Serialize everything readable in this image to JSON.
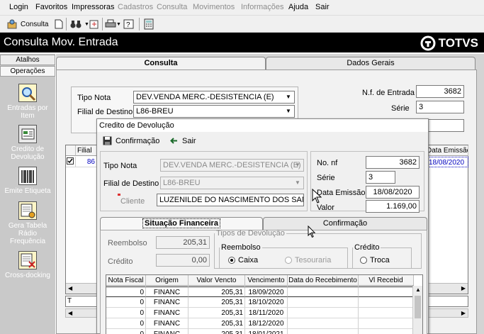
{
  "menu": {
    "items": [
      {
        "label": "Login",
        "enabled": true
      },
      {
        "label": "Favoritos",
        "enabled": true
      },
      {
        "label": "Impressoras",
        "enabled": true
      },
      {
        "label": "Cadastros",
        "enabled": false
      },
      {
        "label": "Consulta",
        "enabled": false
      },
      {
        "label": "Movimentos",
        "enabled": false
      },
      {
        "label": "Informações",
        "enabled": false
      },
      {
        "label": "Ajuda",
        "enabled": true
      },
      {
        "label": "Sair",
        "enabled": true
      }
    ]
  },
  "toolbar": {
    "consulta_label": "Consulta"
  },
  "app": {
    "title": "Consulta Mov. Entrada",
    "logo": "TOTVS"
  },
  "sidebar": {
    "tabs": [
      "Atalhos",
      "Operações"
    ],
    "items": [
      {
        "label": "Entradas por Item",
        "icon": "magnifier-icon"
      },
      {
        "label": "Credito de Devolução",
        "icon": "credit-icon"
      },
      {
        "label": "Emite Etiqueta",
        "icon": "barcode-icon"
      },
      {
        "label": "Gera Tabela Rádio Frequência",
        "icon": "radio-table-icon"
      },
      {
        "label": "Cross-docking",
        "icon": "cross-docking-icon"
      }
    ]
  },
  "main": {
    "tabs": [
      "Consulta",
      "Dados Gerais"
    ],
    "tipo_nota_label": "Tipo Nota",
    "tipo_nota_value": "DEV.VENDA MERC.-DESISTENCIA (E)",
    "filial_label": "Filial de Destino",
    "filial_value": "L86-BREU",
    "nf_entrada_label": "N.f. de Entrada",
    "nf_entrada_value": "3682",
    "serie_label": "Série",
    "serie_value": "3",
    "grid_col_filial": "Filial",
    "grid_col_data_emissao": "Data Emissão",
    "grid_row_filial": "86",
    "grid_row_data": "18/08/2020",
    "footer_cell": "T"
  },
  "dialog": {
    "title": "Credito de Devolução",
    "confirm_label": "Confirmação",
    "exit_label": "Sair",
    "tipo_nota_label": "Tipo Nota",
    "tipo_nota_value": "DEV.VENDA MERC.-DESISTENCIA (E)",
    "filial_label": "Filial de Destino",
    "filial_value": "L86-BREU",
    "cliente_label": "Cliente",
    "cliente_value": "LUZENILDE DO NASCIMENTO DOS SANTOS",
    "no_nf_label": "No. nf",
    "no_nf_value": "3682",
    "serie_label": "Série",
    "serie_value": "3",
    "data_emissao_label": "Data Emissão",
    "data_emissao_value": "18/08/2020",
    "valor_label": "Valor",
    "valor_value": "1.169,00",
    "tabs": [
      "Situação Financeira",
      "Confirmação"
    ],
    "reembolso_label": "Reembolso",
    "reembolso_value": "205,31",
    "credito_label": "Crédito",
    "credito_value": "0,00",
    "tipos_devolucao_legend": "Tipos de Devolução",
    "reembolso_group_legend": "Reembolso",
    "opt_caixa": "Caixa",
    "opt_tesouraria": "Tesouraria",
    "credito_group_legend": "Crédito",
    "opt_troca": "Troca",
    "grid": {
      "headers": [
        "Nota Fiscal",
        "Origem",
        "Valor Vencto",
        "Vencimento",
        "Data do Recebimento",
        "Vl Recebid"
      ],
      "rows": [
        [
          "0",
          "FINANC",
          "205,31",
          "18/09/2020",
          "",
          ""
        ],
        [
          "0",
          "FINANC",
          "205,31",
          "18/10/2020",
          "",
          ""
        ],
        [
          "0",
          "FINANC",
          "205,31",
          "18/11/2020",
          "",
          ""
        ],
        [
          "0",
          "FINANC",
          "205,31",
          "18/12/2020",
          "",
          ""
        ],
        [
          "0",
          "FINANC",
          "205,31",
          "18/01/2021",
          "",
          ""
        ]
      ]
    }
  }
}
